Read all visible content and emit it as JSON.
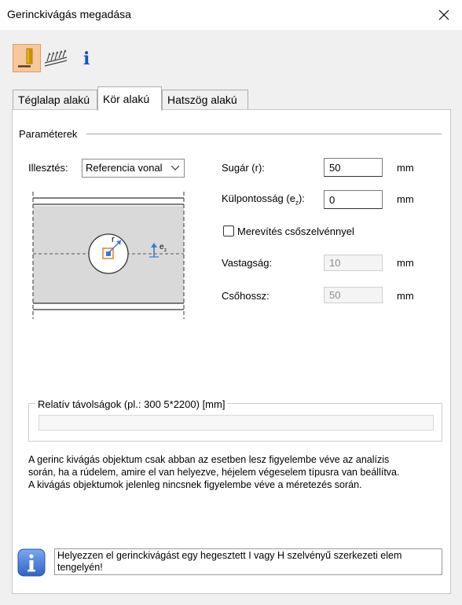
{
  "window": {
    "title": "Gerinckivágás megadása",
    "close_icon": "close-icon"
  },
  "toolbar": {
    "icons": [
      "web-cut-icon",
      "weld-seam-icon",
      "info-icon"
    ]
  },
  "tabs": [
    {
      "label": "Téglalap alakú",
      "active": false
    },
    {
      "label": "Kör alakú",
      "active": true
    },
    {
      "label": "Hatszög alakú",
      "active": false
    }
  ],
  "params": {
    "group_label": "Paraméterek",
    "alignment_label": "Illesztés:",
    "alignment_value": "Referencia vonal",
    "radius_label": "Sugár (r):",
    "radius_value": "50",
    "radius_unit": "mm",
    "eccentricity_label": "Külpontosság (e",
    "eccentricity_sub": "z",
    "eccentricity_suffix": "):",
    "eccentricity_value": "0",
    "eccentricity_unit": "mm",
    "stiffener_label": "Merevítés csőszelvénnyel",
    "stiffener_checked": false,
    "thickness_label": "Vastagság:",
    "thickness_value": "10",
    "thickness_unit": "mm",
    "pipe_length_label": "Csőhossz:",
    "pipe_length_value": "50",
    "pipe_length_unit": "mm"
  },
  "diagram": {
    "r_label": "r",
    "e_label": "e",
    "e_sub": "z"
  },
  "relative": {
    "label": "Relatív távolságok (pl.: 300 5*2200) [mm]",
    "value": ""
  },
  "note_lines": [
    "A gerinc kivágás objektum csak abban az esetben lesz figyelembe véve az analízis",
    "során, ha a rúdelem, amire el van helyezve, héjelem végeselem típusra van beállítva.",
    "A kivágás objektumok jelenleg nincsnek figyelembe véve a méretezés során."
  ],
  "hint": {
    "line1": "Helyezzen el gerinckivágást egy hegesztett I vagy H szelvényű szerkezeti elem",
    "line2": "tengelyén!"
  },
  "colors": {
    "accent": "#3a78d8",
    "active_tool": "#f7c79e",
    "marker_orange": "#e8821f"
  }
}
